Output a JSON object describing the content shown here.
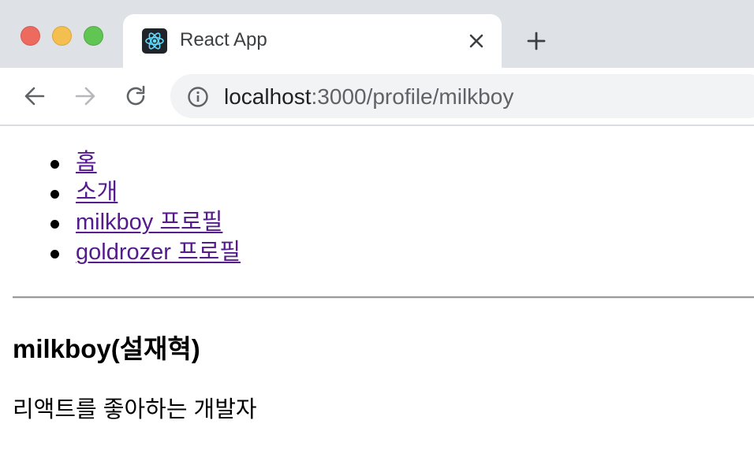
{
  "browser": {
    "tab": {
      "title": "React App",
      "favicon": "react-logo-icon"
    },
    "address_bar": {
      "host": "localhost",
      "path": ":3000/profile/milkboy"
    },
    "icons": {
      "close": "close-icon",
      "new_tab": "plus-icon",
      "back": "back-arrow-icon",
      "forward": "forward-arrow-icon",
      "reload": "reload-icon",
      "site_info": "info-icon"
    },
    "colors": {
      "tabstrip": "#dee1e6",
      "omnibox": "#f1f3f4",
      "traffic_red": "#ed6a5e",
      "traffic_yellow": "#f5bf4f",
      "traffic_green": "#61c554"
    }
  },
  "page": {
    "nav": [
      {
        "label": "홈"
      },
      {
        "label": "소개"
      },
      {
        "label": "milkboy 프로필"
      },
      {
        "label": "goldrozer 프로필"
      }
    ],
    "profile": {
      "heading": "milkboy(설재혁)",
      "description": "리액트를 좋아하는 개발자"
    },
    "colors": {
      "link": "#551a8b",
      "text": "#000000"
    }
  }
}
